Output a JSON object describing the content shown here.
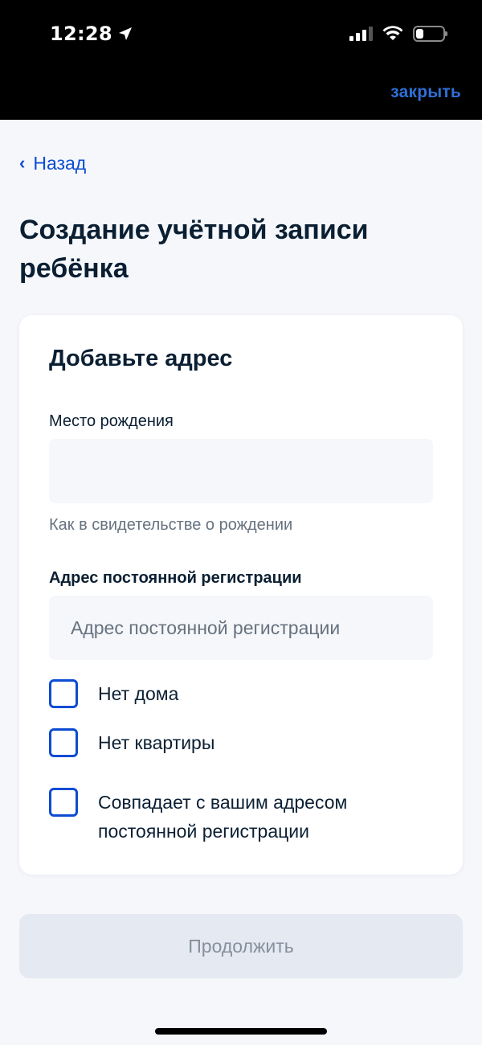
{
  "status_bar": {
    "time": "12:28",
    "location_icon": "location-arrow-icon",
    "battery_level": 0.28
  },
  "browser": {
    "close_label": "закрыть"
  },
  "nav": {
    "back_label": "Назад"
  },
  "page": {
    "title": "Создание учётной записи ребёнка"
  },
  "card": {
    "title": "Добавьте адрес",
    "birthplace": {
      "label": "Место рождения",
      "value": "",
      "hint": "Как в свидетельстве о рождении"
    },
    "registration": {
      "label": "Адрес постоянной регистрации",
      "placeholder": "Адрес постоянной регистрации",
      "value": ""
    },
    "checkboxes": [
      {
        "label": "Нет дома",
        "checked": false
      },
      {
        "label": "Нет квартиры",
        "checked": false
      },
      {
        "label": "Совпадает с вашим адресом постоянной регистрации",
        "checked": false
      }
    ]
  },
  "actions": {
    "continue_label": "Продолжить"
  },
  "colors": {
    "accent": "#0d4cd3",
    "close_link": "#2f6fd6",
    "text": "#0b1f33",
    "hint": "#66727f",
    "disabled_button_bg": "#e4e9f2"
  }
}
